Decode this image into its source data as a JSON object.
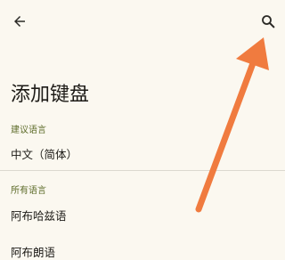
{
  "header": {
    "back_icon": "arrow-left-icon",
    "search_icon": "search-icon"
  },
  "page": {
    "title": "添加键盘"
  },
  "sections": [
    {
      "label": "建议语言",
      "items": [
        "中文（简体）"
      ]
    },
    {
      "label": "所有语言",
      "items": [
        "阿布哈兹语",
        "阿布朗语"
      ]
    }
  ],
  "colors": {
    "background": "#fbf8f0",
    "section_label": "#5e6c2a",
    "annotation_arrow": "#f07b3f"
  }
}
